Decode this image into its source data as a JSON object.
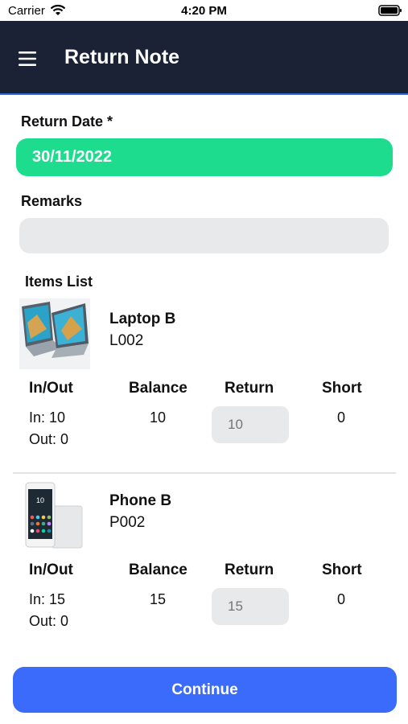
{
  "status_bar": {
    "carrier": "Carrier",
    "time": "4:20 PM",
    "icons": [
      "wifi-icon",
      "battery-icon"
    ]
  },
  "header": {
    "title": "Return Note",
    "menu_icon": "hamburger-menu-icon",
    "background_color": "#1b2236"
  },
  "form": {
    "return_date_label": "Return Date *",
    "return_date_value": "30/11/2022",
    "return_date_color": "#1ddc8e",
    "remarks_label": "Remarks",
    "remarks_value": "",
    "items_list_label": "Items List"
  },
  "columns": {
    "in_out": "In/Out",
    "balance": "Balance",
    "return": "Return",
    "short": "Short"
  },
  "items": [
    {
      "name": "Laptop B",
      "code": "L002",
      "image": "laptop-image",
      "in": "In: 10",
      "out": "Out: 0",
      "balance": "10",
      "return_placeholder": "10",
      "short": "0"
    },
    {
      "name": "Phone B",
      "code": "P002",
      "image": "phone-image",
      "in": "In: 15",
      "out": "Out: 0",
      "balance": "15",
      "return_placeholder": "15",
      "short": "0"
    }
  ],
  "footer": {
    "continue_label": "Continue",
    "button_color": "#3a6bfa"
  }
}
